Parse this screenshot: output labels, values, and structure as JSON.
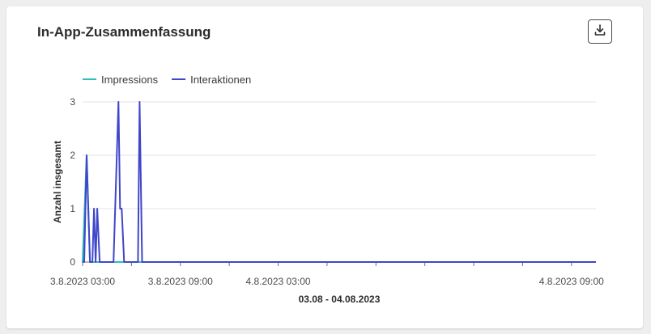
{
  "widget": {
    "title": "In-App-Zusammenfassung",
    "download_icon": "download-icon"
  },
  "chart_data": {
    "type": "line",
    "title": "In-App-Zusammenfassung",
    "xlabel": "03.08 - 04.08.2023",
    "ylabel": "Anzahl insgesamt",
    "ylim": [
      0,
      3
    ],
    "yticks": [
      "0",
      "1",
      "2",
      "3"
    ],
    "x_range_hours": [
      0,
      31.5
    ],
    "x_ticks_hours": [
      0,
      3,
      6,
      9,
      12,
      15,
      18,
      21,
      24,
      27,
      30
    ],
    "x_tick_labels": [
      {
        "hour": 0,
        "label": "3.8.2023 03:00"
      },
      {
        "hour": 6,
        "label": "3.8.2023 09:00"
      },
      {
        "hour": 12,
        "label": "4.8.2023 03:00"
      },
      {
        "hour": 30,
        "label": "4.8.2023 09:00"
      }
    ],
    "grid": true,
    "legend_position": "top-left",
    "series": [
      {
        "name": "Impressions",
        "color": "#2dc0b5",
        "points": [
          [
            0,
            0
          ],
          [
            0.25,
            2
          ],
          [
            0.45,
            0
          ],
          [
            31.5,
            0
          ]
        ]
      },
      {
        "name": "Interaktionen",
        "color": "#4046ca",
        "points": [
          [
            0,
            0
          ],
          [
            0.1,
            0
          ],
          [
            0.25,
            2
          ],
          [
            0.45,
            0
          ],
          [
            0.6,
            0
          ],
          [
            0.7,
            1
          ],
          [
            0.8,
            0
          ],
          [
            0.9,
            1
          ],
          [
            1.05,
            0
          ],
          [
            1.9,
            0
          ],
          [
            2.2,
            3
          ],
          [
            2.3,
            1
          ],
          [
            2.4,
            1
          ],
          [
            2.55,
            0
          ],
          [
            3.4,
            0
          ],
          [
            3.5,
            3
          ],
          [
            3.65,
            0
          ],
          [
            31.5,
            0
          ]
        ]
      }
    ]
  }
}
